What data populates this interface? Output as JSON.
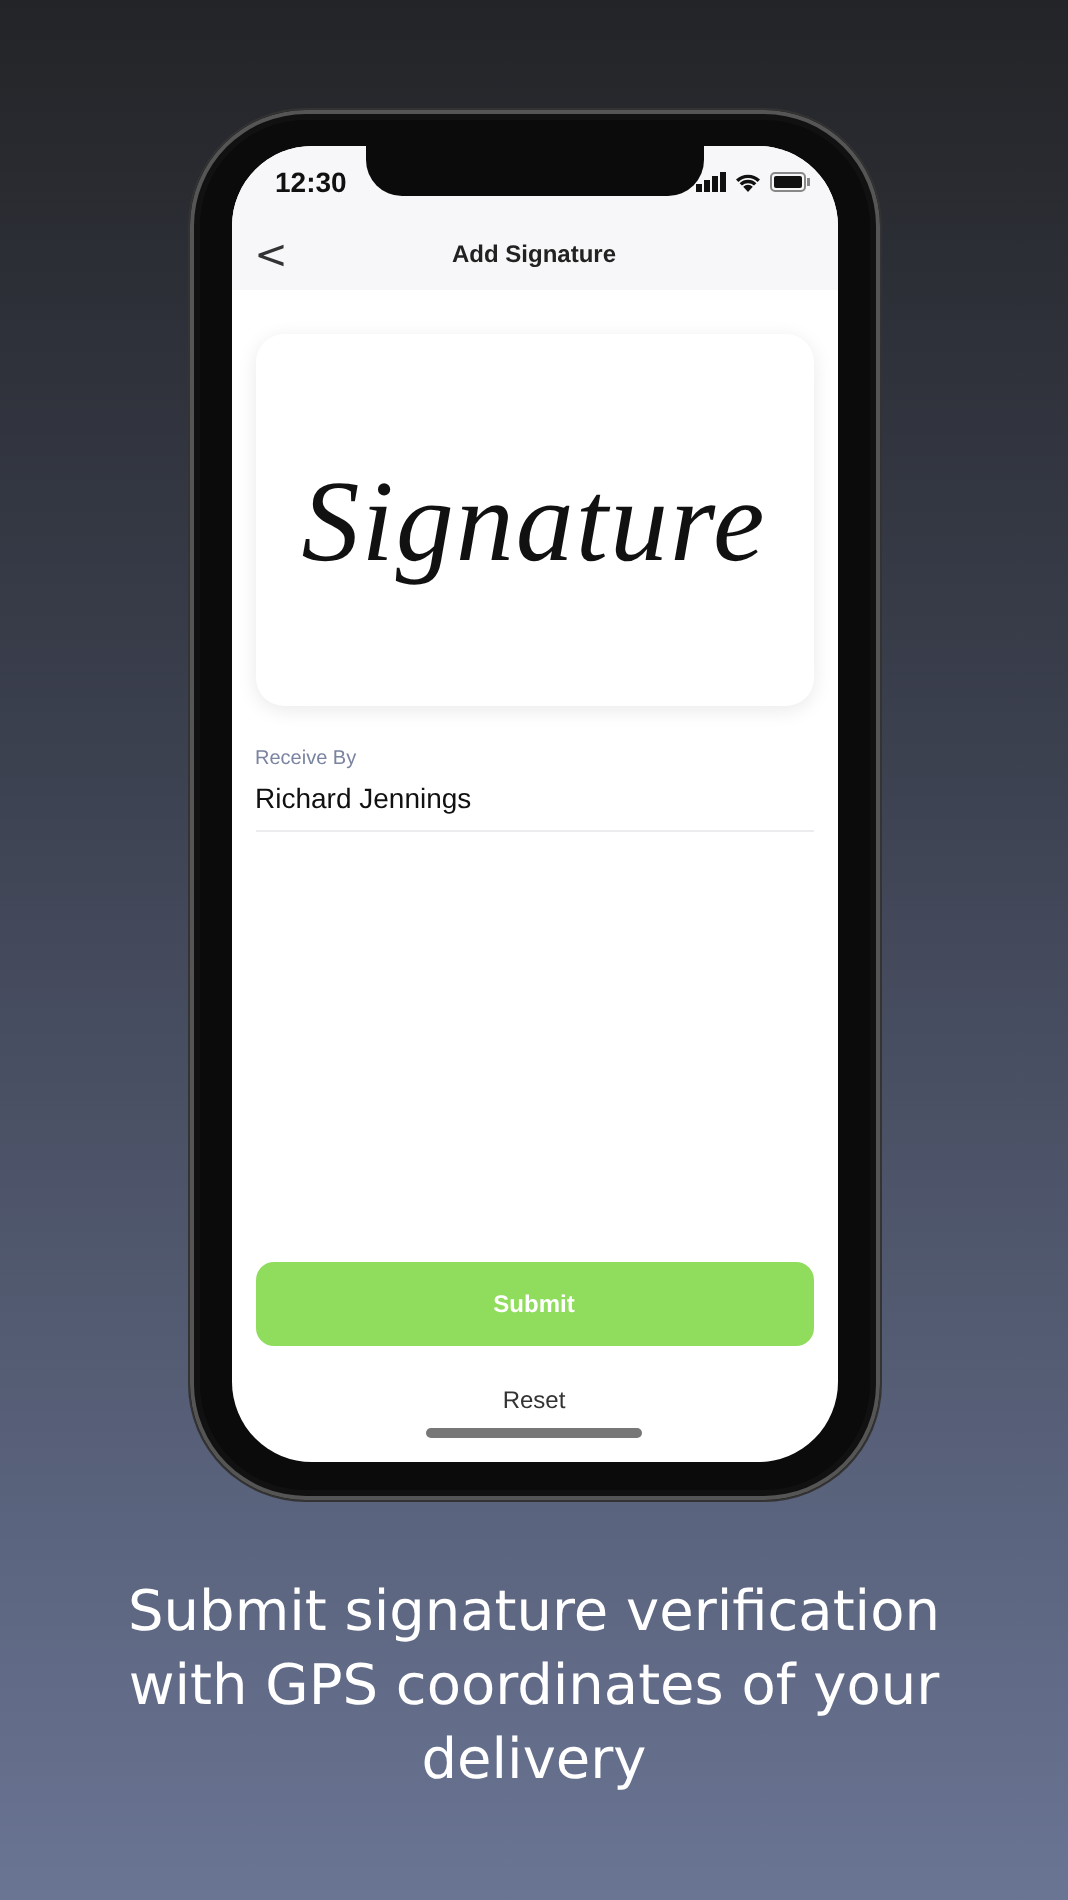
{
  "status_bar": {
    "time": "12:30"
  },
  "nav_bar": {
    "back": "<",
    "title": "Add Signature"
  },
  "signature_pad": {
    "signature": "Signature"
  },
  "receive_by": {
    "label": "Receive By",
    "value": "Richard Jennings"
  },
  "buttons": [
    {
      "label": "Submit",
      "kind": "primary"
    },
    {
      "label": "Reset",
      "kind": "text"
    }
  ],
  "caption": "Submit signature verification with GPS coordinates of your delivery"
}
